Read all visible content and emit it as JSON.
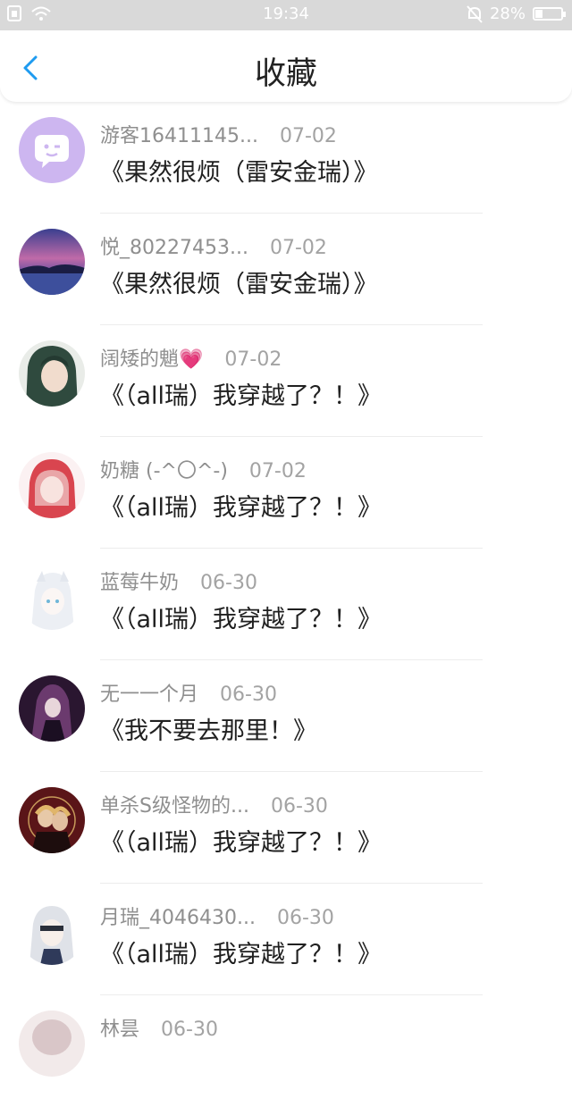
{
  "status": {
    "time": "19:34",
    "battery": "28%",
    "battery_level": 0.28
  },
  "header": {
    "title": "收藏"
  },
  "items": [
    {
      "user": "游客16411145...",
      "date": "07-02",
      "book": "《果然很烦（雷安金瑞）》"
    },
    {
      "user": "悦_80227453...",
      "date": "07-02",
      "book": "《果然很烦（雷安金瑞）》"
    },
    {
      "user": "阔矮的魈💗",
      "date": "07-02",
      "book": "《（all瑞）我穿越了？！》"
    },
    {
      "user": "奶糖 (-^〇^-)",
      "date": "07-02",
      "book": "《（all瑞）我穿越了？！》"
    },
    {
      "user": "蓝莓牛奶",
      "date": "06-30",
      "book": "《（all瑞）我穿越了？！》"
    },
    {
      "user": "无一一个月",
      "date": "06-30",
      "book": "《我不要去那里！》"
    },
    {
      "user": "单杀S级怪物的...",
      "date": "06-30",
      "book": "《（all瑞）我穿越了？！》"
    },
    {
      "user": "月瑞_4046430...",
      "date": "06-30",
      "book": "《（all瑞）我穿越了？！》"
    },
    {
      "user": "林昙",
      "date": "06-30",
      "book": ""
    }
  ]
}
